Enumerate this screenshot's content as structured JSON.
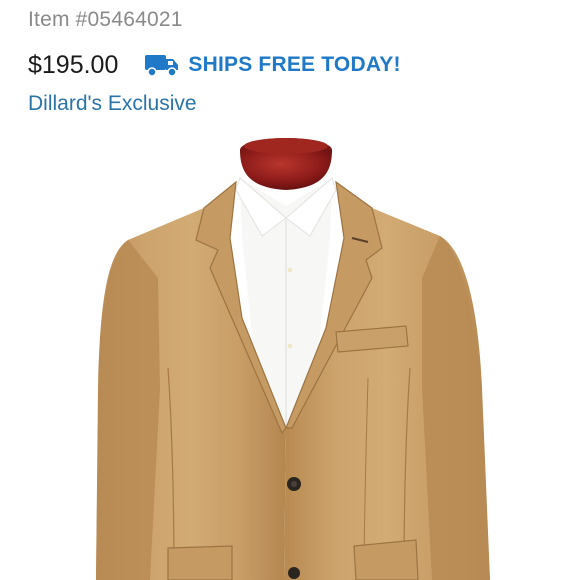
{
  "product": {
    "item_number": "Item #05464021",
    "price": "$195.00",
    "shipping_text": "SHIPS FREE TODAY!",
    "shipping_icon": "truck-icon",
    "badge": "Dillard's Exclusive",
    "image_description_icon": "tan-blazer-product-image"
  },
  "colors": {
    "shipping_blue": "#1f79c7",
    "link_blue": "#2a74a8",
    "jacket_tan": "#c9a06a",
    "mannequin_red": "#8e1c1a"
  }
}
